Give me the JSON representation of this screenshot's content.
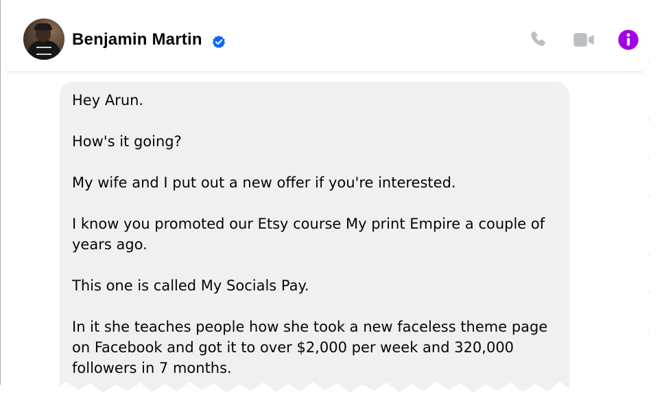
{
  "contact": {
    "name": "Benjamin Martin",
    "verified": true,
    "avatar_icon": "profile-photo"
  },
  "header_actions": {
    "call_icon": "phone-icon",
    "video_icon": "video-camera-icon",
    "info_icon": "info-icon",
    "icon_color": "#bcc0c4",
    "info_color": "#a200e5",
    "verified_color": "#0866ff"
  },
  "message": {
    "paragraphs": [
      "Hey Arun.",
      "How's it going?",
      "My wife and I put out a new offer if you're interested.",
      "I know you promoted our Etsy course My print Empire a couple of years ago.",
      "This one is called My Socials Pay.",
      "In it she teaches people how she took a new faceless theme page on Facebook and got it to over $2,000 per week and 320,000 followers in 7 months."
    ]
  },
  "colors": {
    "bubble_bg": "#f0f0f0",
    "text": "#050505"
  }
}
